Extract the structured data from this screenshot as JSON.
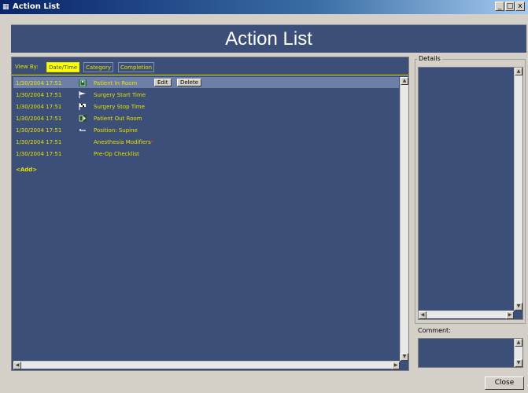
{
  "window": {
    "title": "Action List",
    "min": "_",
    "max": "□",
    "close": "x"
  },
  "header": {
    "title": "Action List"
  },
  "view_by": {
    "label": "View By:",
    "options": [
      "Date/Time",
      "Category",
      "Completion"
    ],
    "selected": "Date/Time"
  },
  "actions": [
    {
      "datetime": "1/30/2004 17:51",
      "icon": "patient-in-room-icon",
      "name": "Patient In Room",
      "selected": true,
      "edit_label": "Edit",
      "delete_label": "Delete"
    },
    {
      "datetime": "1/30/2004 17:51",
      "icon": "flag-start-icon",
      "name": "Surgery Start Time"
    },
    {
      "datetime": "1/30/2004 17:51",
      "icon": "flag-stop-icon",
      "name": "Surgery Stop Time"
    },
    {
      "datetime": "1/30/2004 17:51",
      "icon": "patient-out-room-icon",
      "name": "Patient Out Room"
    },
    {
      "datetime": "1/30/2004 17:51",
      "icon": "position-icon",
      "name": "Position: Supine"
    },
    {
      "datetime": "1/30/2004 17:51",
      "icon": "",
      "name": "Anesthesia Modifiers",
      "marker": "*"
    },
    {
      "datetime": "1/30/2004 17:51",
      "icon": "",
      "name": "Pre-Op Checklist"
    }
  ],
  "add_label": "<Add>",
  "details": {
    "label": "Details"
  },
  "comment": {
    "label": "Comment:"
  },
  "buttons": {
    "close": "Close"
  },
  "colors": {
    "panel": "#3b4f78",
    "accent": "#e6e000",
    "selected_row": "#6d7fa8"
  }
}
